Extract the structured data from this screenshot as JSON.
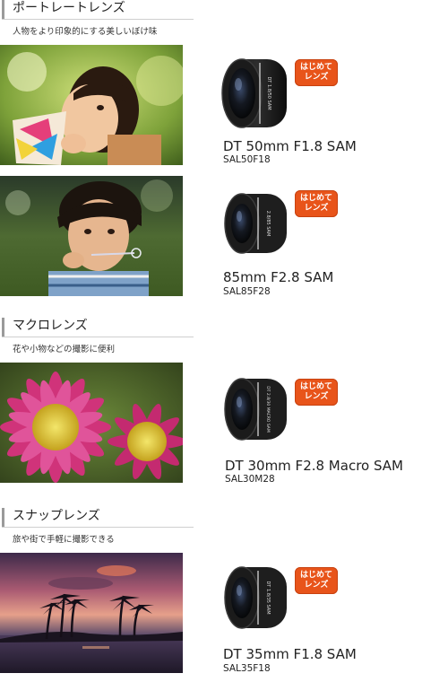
{
  "sections": [
    {
      "title": "ポートレートレンズ",
      "subtitle": "人物をより印象的にする美しいぼけ味",
      "products": [
        {
          "image_desc": "girl-with-colorful-toy",
          "badge": [
            "はじめて",
            "レンズ"
          ],
          "name": "DT 50mm F1.8 SAM",
          "code": "SAL50F18",
          "lens_text": "DT 1.8/50 SAM"
        },
        {
          "image_desc": "boy-blowing-bubbles",
          "badge": [
            "はじめて",
            "レンズ"
          ],
          "name": "85mm F2.8 SAM",
          "code": "SAL85F28",
          "lens_text": "2.8/85 SAM"
        }
      ]
    },
    {
      "title": "マクロレンズ",
      "subtitle": "花や小物などの撮影に便利",
      "products": [
        {
          "image_desc": "pink-flowers",
          "badge": [
            "はじめて",
            "レンズ"
          ],
          "name": "DT 30mm F2.8 Macro SAM",
          "code": "SAL30M28",
          "lens_text": "DT 2.8/30 MACRO SAM"
        }
      ]
    },
    {
      "title": "スナップレンズ",
      "subtitle": "旅や街で手軽に撮影できる",
      "products": [
        {
          "image_desc": "palm-tree-sunset",
          "badge": [
            "はじめて",
            "レンズ"
          ],
          "name": "DT 35mm F1.8 SAM",
          "code": "SAL35F18",
          "lens_text": "DT 1.8/35 SAM"
        }
      ]
    }
  ],
  "colors": {
    "badge": "#e8541a",
    "text": "#222222",
    "bar": "#9a9a9a"
  }
}
